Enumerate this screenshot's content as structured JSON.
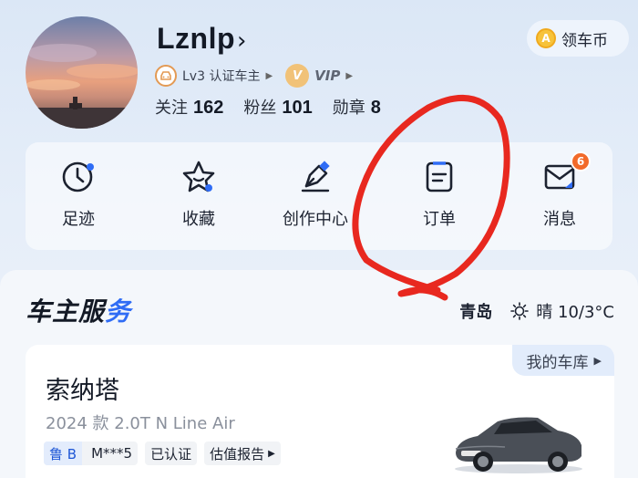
{
  "profile": {
    "username": "Lznlp",
    "username_chevron": "›",
    "level_badge": "Lv3 认证车主",
    "vip_label": "VIP",
    "vip_icon_letter": "V",
    "stats": [
      {
        "label": "关注",
        "value": "162"
      },
      {
        "label": "粉丝",
        "value": "101"
      },
      {
        "label": "勋章",
        "value": "8"
      }
    ]
  },
  "coin_button": {
    "label": "领车币",
    "icon_letter": "A"
  },
  "quick_menu": [
    {
      "label": "足迹",
      "icon": "clock-icon"
    },
    {
      "label": "收藏",
      "icon": "star-icon"
    },
    {
      "label": "创作中心",
      "icon": "pen-icon"
    },
    {
      "label": "订单",
      "icon": "order-icon"
    },
    {
      "label": "消息",
      "icon": "mail-icon",
      "badge": "6"
    }
  ],
  "service": {
    "title_part1": "车主服",
    "title_part2": "务",
    "city": "青岛",
    "weather": "晴 10/3°C"
  },
  "car": {
    "garage_label": "我的车库",
    "name": "索纳塔",
    "model": "2024 款 2.0T N Line Air",
    "plate_province": "鲁 B",
    "plate_number": "M***5",
    "verified": "已认证",
    "valuation": "估值报告"
  },
  "colors": {
    "accent": "#2f6cf5",
    "badge": "#f26a2a",
    "annotation": "#e8281f"
  }
}
